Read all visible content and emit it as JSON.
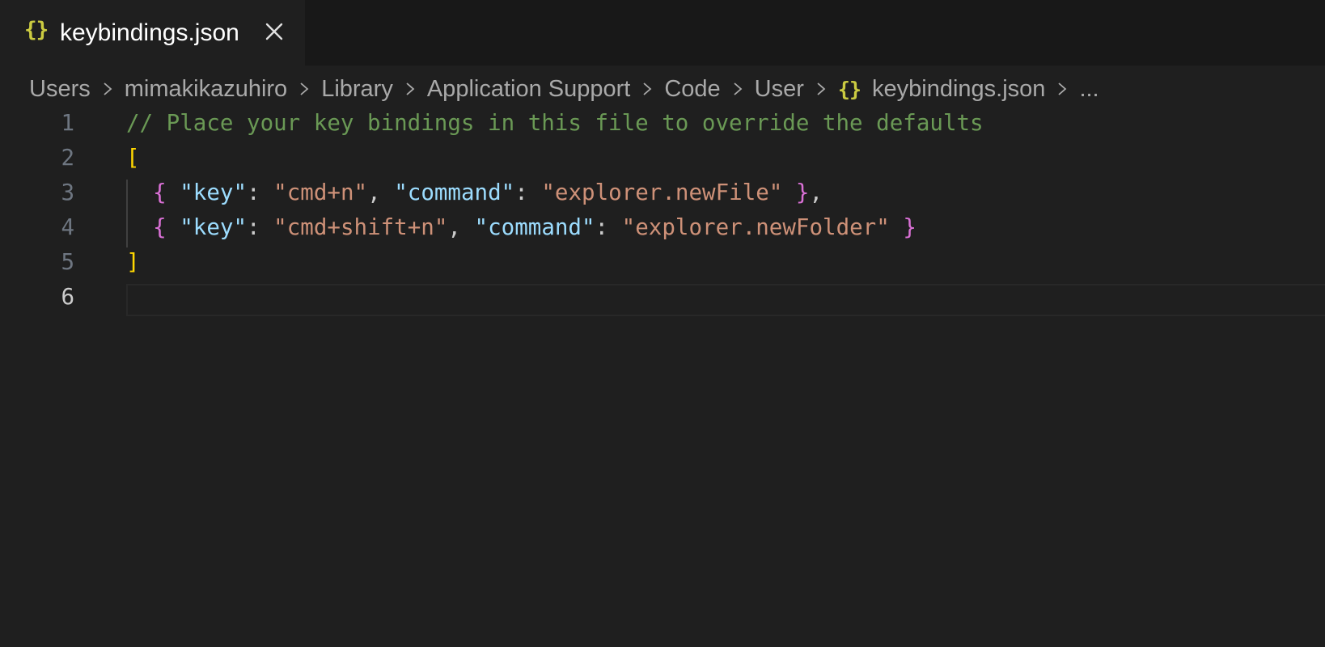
{
  "tab": {
    "icon": "{}",
    "label": "keybindings.json",
    "close_icon": "close-icon"
  },
  "breadcrumb": {
    "items": [
      "Users",
      "mimakikazuhiro",
      "Library",
      "Application Support",
      "Code",
      "User"
    ],
    "file_icon": "{}",
    "file": "keybindings.json",
    "more": "..."
  },
  "editor": {
    "line_numbers": [
      "1",
      "2",
      "3",
      "4",
      "5",
      "6"
    ],
    "active_line": 6,
    "line1": {
      "comment": "// Place your key bindings in this file to override the defaults"
    },
    "line2": {
      "open_bracket": "["
    },
    "line3": {
      "open_brace": "{",
      "key_prop": "\"key\"",
      "colon1": ": ",
      "key_value": "\"cmd+n\"",
      "comma1": ", ",
      "command_prop": "\"command\"",
      "colon2": ": ",
      "command_value": "\"explorer.newFile\"",
      "close_brace": "}",
      "trailing_comma": ","
    },
    "line4": {
      "open_brace": "{",
      "key_prop": "\"key\"",
      "colon1": ": ",
      "key_value": "\"cmd+shift+n\"",
      "comma1": ", ",
      "command_prop": "\"command\"",
      "colon2": ": ",
      "command_value": "\"explorer.newFolder\"",
      "close_brace": "}"
    },
    "line5": {
      "close_bracket": "]"
    }
  },
  "colors": {
    "background": "#1f1f1f",
    "comment": "#6a9955",
    "bracket": "#ffd700",
    "brace": "#da70d6",
    "property": "#9cdcfe",
    "string": "#ce9178",
    "json_icon": "#cbcb41"
  }
}
